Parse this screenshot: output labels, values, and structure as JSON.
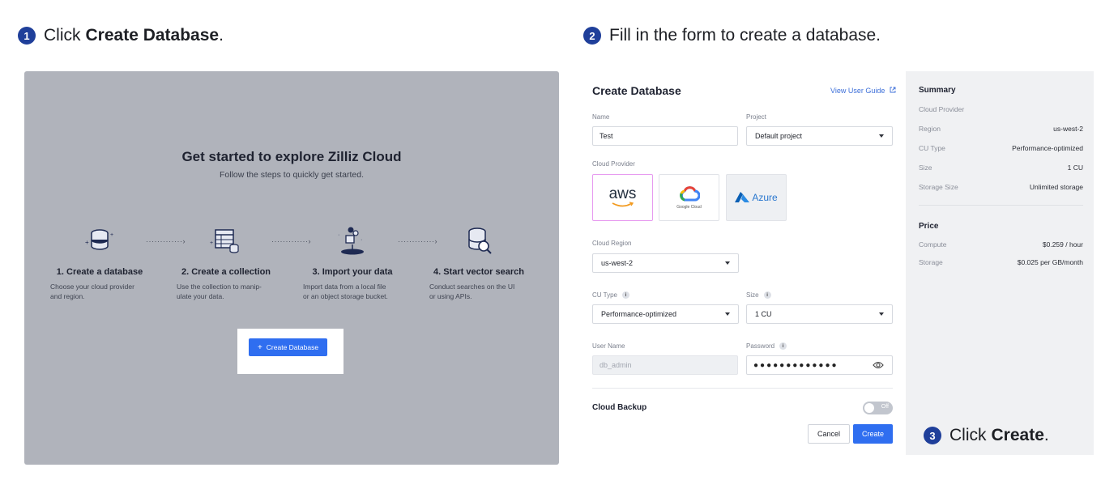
{
  "steps": [
    {
      "num": "1",
      "prefix": "Click",
      "bold": "Create Database",
      "suffix": "."
    },
    {
      "num": "2",
      "text": "Fill in the form to create a database."
    },
    {
      "num": "3",
      "prefix": "Click",
      "bold": "Create",
      "suffix": "."
    }
  ],
  "onboarding": {
    "title": "Get started to explore Zilliz Cloud",
    "subtitle": "Follow the steps to quickly get started.",
    "items": [
      {
        "title": "1. Create a database",
        "desc": "Choose your cloud provider\nand region."
      },
      {
        "title": "2. Create a collection",
        "desc": "Use the collection to manip-\nulate your data."
      },
      {
        "title": "3. Import your data",
        "desc": "Import data from a local file\nor an object storage bucket."
      },
      {
        "title": "4. Start vector search",
        "desc": "Conduct searches on the UI\nor using APIs."
      }
    ],
    "arrow": "·············›",
    "cta_label": "Create Database"
  },
  "form": {
    "title": "Create Database",
    "guide_link": "View User Guide",
    "name_label": "Name",
    "name_value": "Test",
    "project_label": "Project",
    "project_value": "Default project",
    "provider_label": "Cloud Provider",
    "providers": {
      "aws": "aws",
      "gcp": "Google Cloud",
      "azure": "Azure"
    },
    "region_label": "Cloud Region",
    "region_value": "us-west-2",
    "cu_type_label": "CU Type",
    "cu_type_value": "Performance-optimized",
    "size_label": "Size",
    "size_value": "1 CU",
    "username_label": "User Name",
    "username_placeholder": "db_admin",
    "password_label": "Password",
    "password_value": "●●●●●●●●●●●●●",
    "info_glyph": "i",
    "backup_label": "Cloud Backup",
    "backup_state": "Off",
    "cancel_label": "Cancel",
    "create_label": "Create"
  },
  "summary": {
    "title": "Summary",
    "rows": [
      {
        "label": "Cloud Provider",
        "value": ""
      },
      {
        "label": "Region",
        "value": "us-west-2"
      },
      {
        "label": "CU Type",
        "value": "Performance-optimized"
      },
      {
        "label": "Size",
        "value": "1 CU"
      },
      {
        "label": "Storage Size",
        "value": "Unlimited storage"
      }
    ],
    "price_title": "Price",
    "price_rows": [
      {
        "label": "Compute",
        "value": "$0.259 / hour"
      },
      {
        "label": "Storage",
        "value": "$0.025 per GB/month"
      }
    ]
  },
  "colors": {
    "primary": "#2f6ef0",
    "badge": "#1f3f9a",
    "panel": "#b0b3bb",
    "summary_bg": "#f0f1f3"
  }
}
